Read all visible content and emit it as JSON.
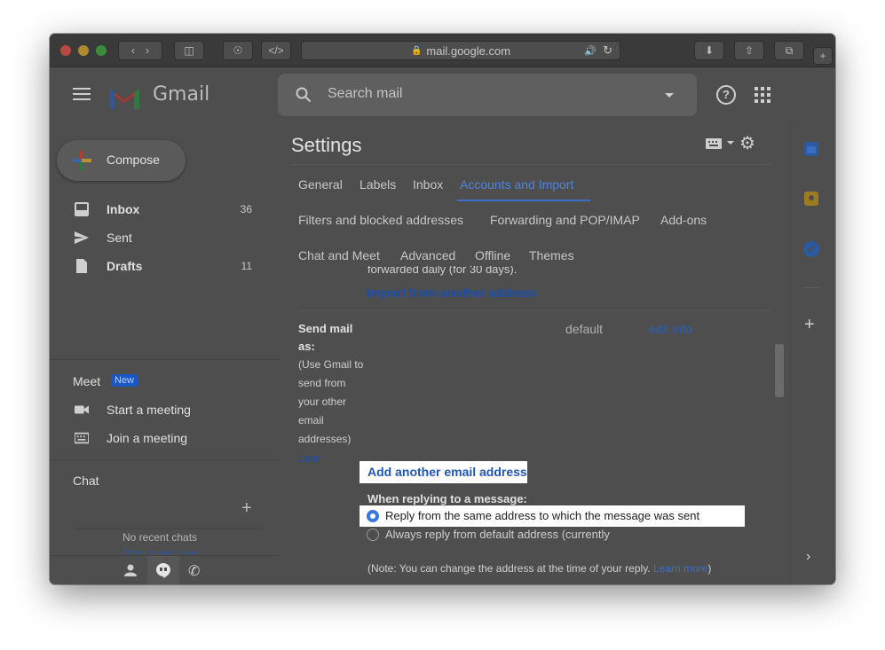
{
  "browser": {
    "url": "mail.google.com"
  },
  "app": {
    "logo_text": "Gmail"
  },
  "search": {
    "placeholder": "Search mail"
  },
  "sidebar": {
    "compose_label": "Compose",
    "items": [
      {
        "label": "Inbox",
        "count": "36",
        "bold": true
      },
      {
        "label": "Sent",
        "count": "",
        "bold": false
      },
      {
        "label": "Drafts",
        "count": "11",
        "bold": true
      }
    ],
    "meet": {
      "label": "Meet",
      "badge": "New",
      "start": "Start a meeting",
      "join": "Join a meeting"
    },
    "chat": {
      "label": "Chat",
      "empty_text": "No recent chats",
      "start_link": "Start a new one"
    }
  },
  "settings": {
    "title": "Settings",
    "tabs_row1": [
      "General",
      "Labels",
      "Inbox",
      "Accounts and Import"
    ],
    "tabs_row2": [
      "Filters and blocked addresses",
      "Forwarding and POP/IMAP",
      "Add-ons"
    ],
    "tabs_row3": [
      "Chat and Meet",
      "Advanced",
      "Offline",
      "Themes"
    ],
    "active_tab": "Accounts and Import",
    "import_partial": "forwarded daily (for 30 days).",
    "import_link": "Import from another address",
    "send_mail_as": {
      "title_line1": "Send mail",
      "title_line2": "as:",
      "desc": [
        "(Use Gmail to",
        "send from",
        "your other",
        "email",
        "addresses)"
      ],
      "learn_partial": "Lear",
      "default_label": "default",
      "edit_info": "edit info",
      "add_address": "Add another email address",
      "replying_label": "When replying to a message:",
      "option_same": "Reply from the same address to which the message was sent",
      "option_default": "Always reply from default address (currently",
      "note": "(Note: You can change the address at the time of your reply.",
      "note_link": "Learn more",
      "note_end": ")"
    }
  }
}
